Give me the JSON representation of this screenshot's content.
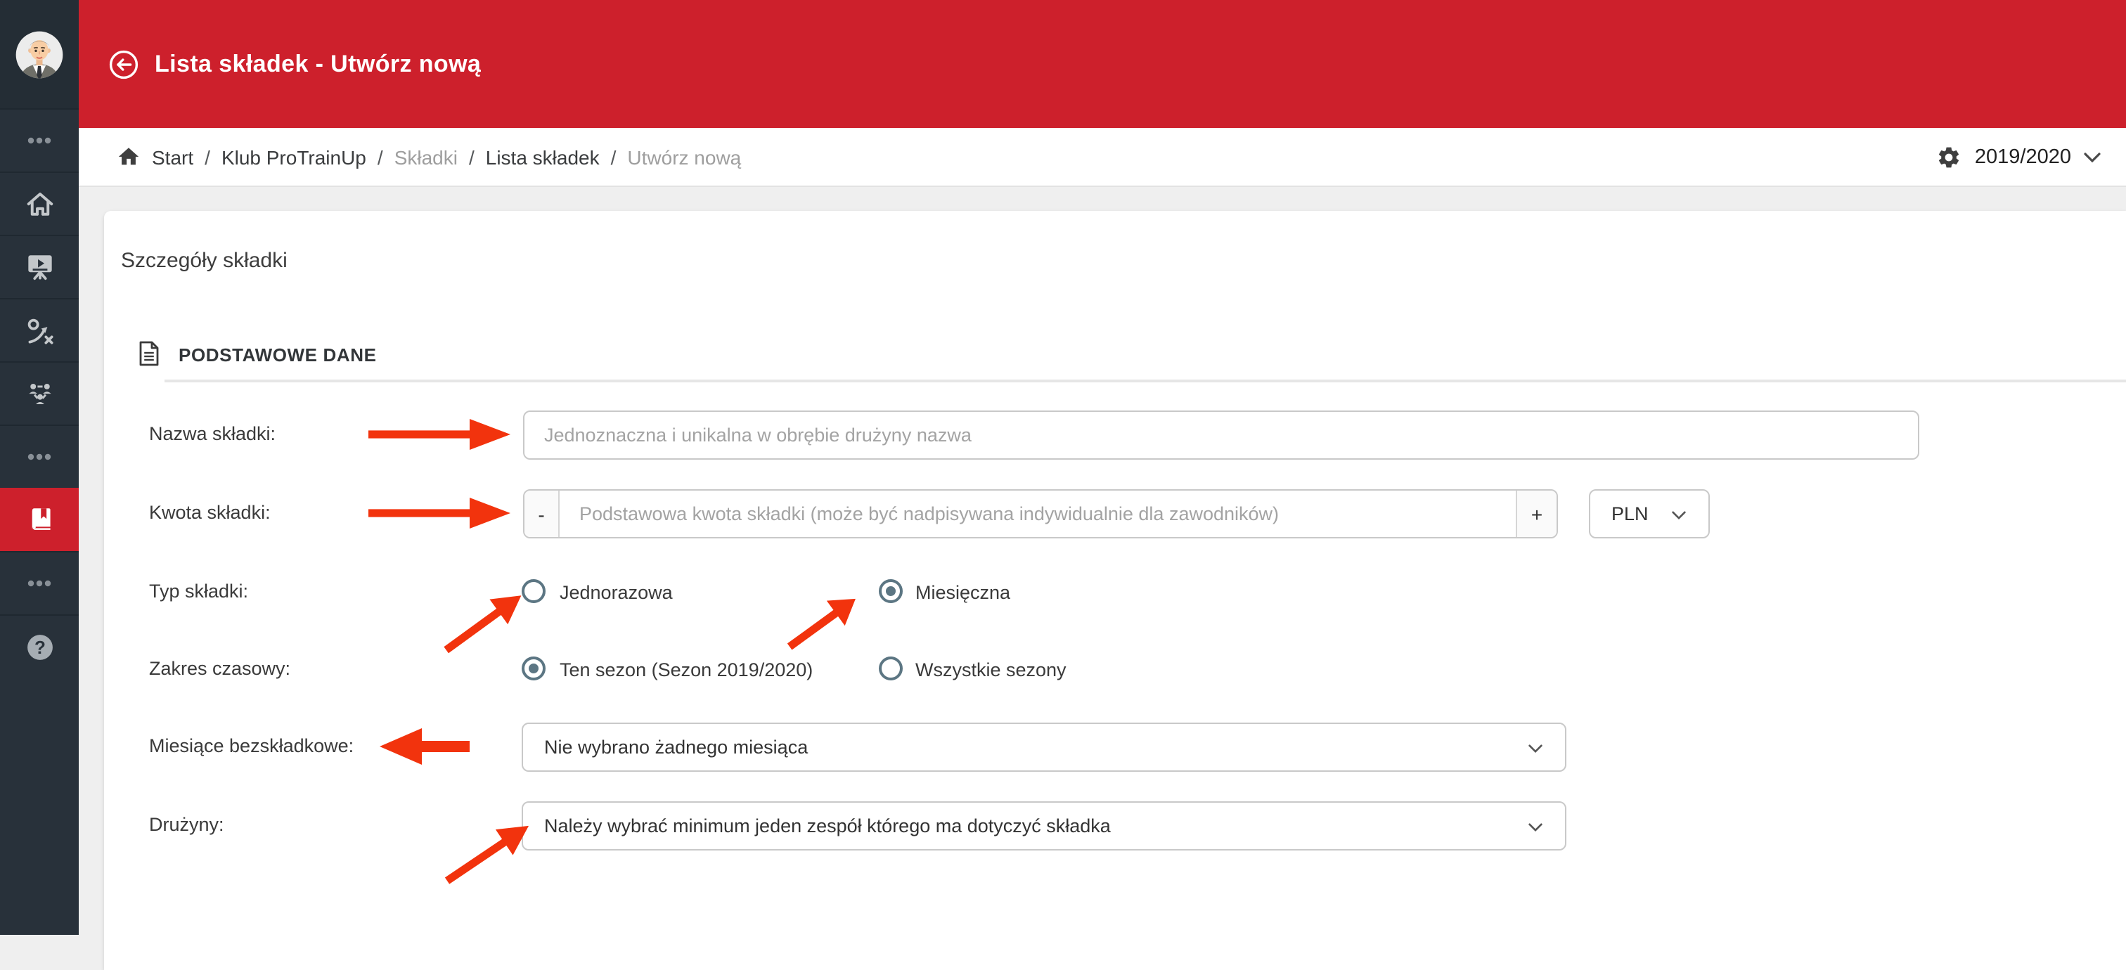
{
  "header": {
    "title": "Lista składek - Utwórz nową"
  },
  "breadcrumb": {
    "separator": "/",
    "items": [
      {
        "label": "Start",
        "muted": false
      },
      {
        "label": "Klub ProTrainUp",
        "muted": false
      },
      {
        "label": "Składki",
        "muted": true
      },
      {
        "label": "Lista składek",
        "muted": false
      },
      {
        "label": "Utwórz nową",
        "muted": true
      }
    ],
    "season": "2019/2020"
  },
  "sidebar": {
    "items": [
      {
        "icon": "more-dots",
        "active": false
      },
      {
        "icon": "home",
        "active": false
      },
      {
        "icon": "trainings-board",
        "active": false
      },
      {
        "icon": "tactics",
        "active": false
      },
      {
        "icon": "team-structure",
        "active": false
      },
      {
        "icon": "more-dots",
        "active": false
      },
      {
        "icon": "payments-book",
        "active": true
      },
      {
        "icon": "more-dots",
        "active": false
      },
      {
        "icon": "help",
        "active": false
      }
    ],
    "help_glyph": "?"
  },
  "card": {
    "title": "Szczegóły składki",
    "section_title": "PODSTAWOWE DANE",
    "fields": {
      "nazwa": {
        "label": "Nazwa składki:",
        "placeholder": "Jednoznaczna i unikalna w obrębie drużyny nazwa",
        "value": ""
      },
      "kwota": {
        "label": "Kwota składki:",
        "placeholder": "Podstawowa kwota składki (może być nadpisywana indywidualnie dla zawodników)",
        "value": "",
        "minus": "-",
        "plus": "+",
        "currency": "PLN"
      },
      "typ": {
        "label": "Typ składki:",
        "options": [
          {
            "label": "Jednorazowa",
            "checked": false
          },
          {
            "label": "Miesięczna",
            "checked": true
          }
        ]
      },
      "zakres": {
        "label": "Zakres czasowy:",
        "options": [
          {
            "label": "Ten sezon (Sezon 2019/2020)",
            "checked": true
          },
          {
            "label": "Wszystkie sezony",
            "checked": false
          }
        ]
      },
      "miesiace": {
        "label": "Miesiące bezskładkowe:",
        "value": "Nie wybrano żadnego miesiąca"
      },
      "druzyny": {
        "label": "Drużyny:",
        "value": "Należy wybrać minimum jeden zespół którego ma dotyczyć składka"
      }
    }
  },
  "colors": {
    "brand_red": "#cd202c",
    "annotation_arrow_red": "#f2330d",
    "sidebar_bg": "#28313a",
    "radio_slate": "#5c7683"
  }
}
